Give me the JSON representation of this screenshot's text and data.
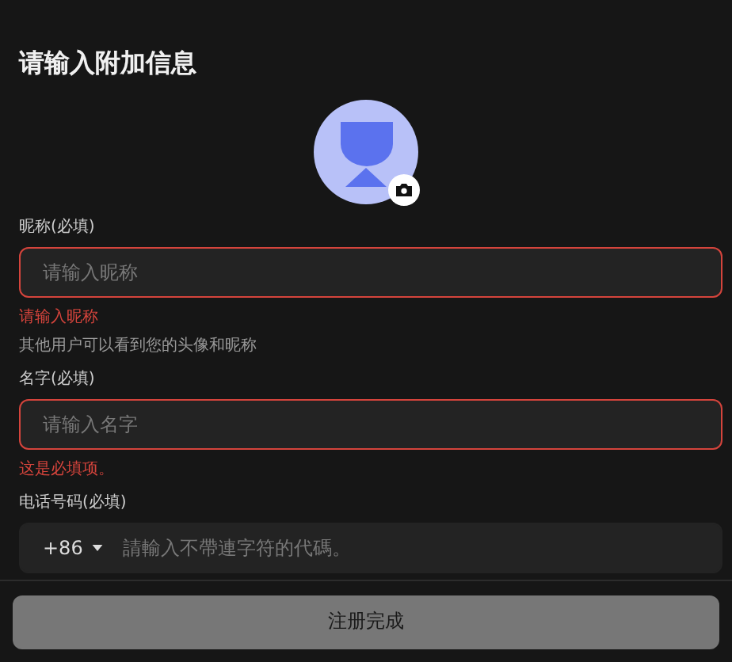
{
  "title": "请输入附加信息",
  "fields": [
    {
      "kind": "text",
      "label": "昵称(必填)",
      "placeholder": "请输入昵称",
      "error": "请输入昵称",
      "help": "其他用户可以看到您的头像和昵称"
    },
    {
      "kind": "text",
      "label": "名字(必填)",
      "placeholder": "请输入名字",
      "error": "这是必填项。"
    },
    {
      "kind": "phone",
      "label": "电话号码(必填)",
      "country_code": "+86",
      "placeholder": "請輸入不帶連字符的代碼。"
    }
  ],
  "submit_button": "注册完成"
}
